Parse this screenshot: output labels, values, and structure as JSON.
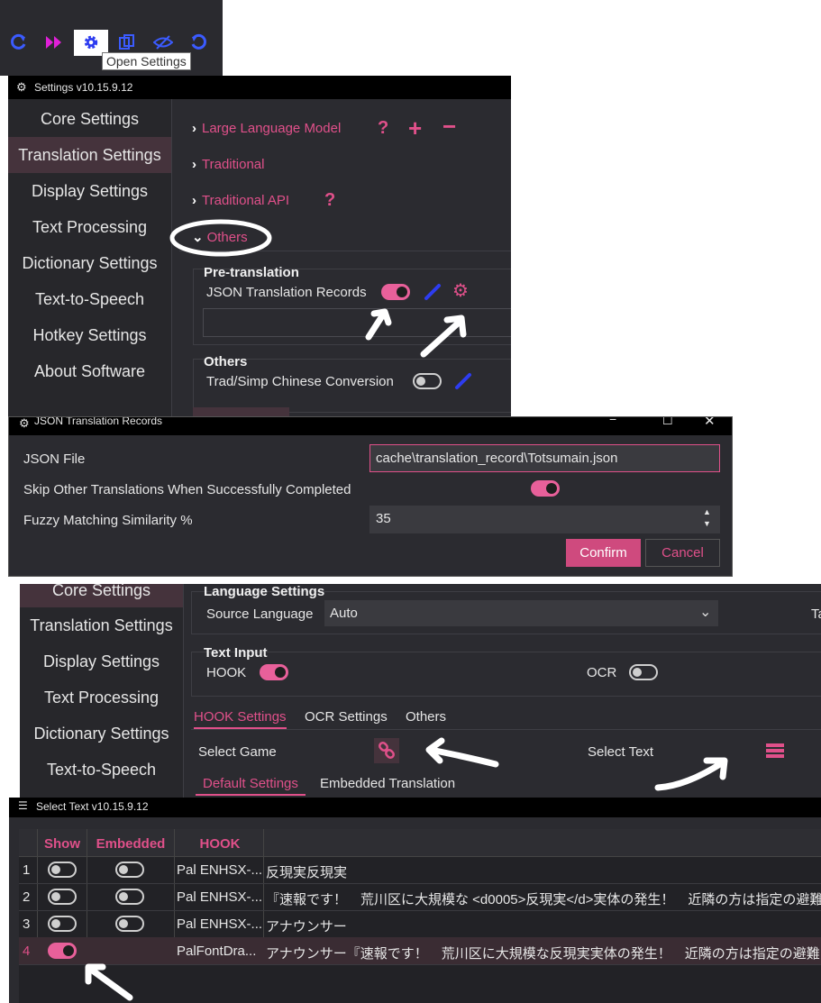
{
  "toolbar": {
    "tooltip": "Open Settings",
    "icons": [
      "reload-icon",
      "fast-forward-icon",
      "gear-icon",
      "copy-icon",
      "eye-slash-icon",
      "undo-icon"
    ]
  },
  "settings_window": {
    "title": "Settings v10.15.9.12",
    "nav": [
      "Core Settings",
      "Translation Settings",
      "Display Settings",
      "Text Processing",
      "Dictionary Settings",
      "Text-to-Speech",
      "Hotkey Settings",
      "About Software"
    ],
    "sections": [
      "Large Language Model",
      "Traditional",
      "Traditional API",
      "Others"
    ],
    "pretranslation_title": "Pre-translation",
    "json_records_label": "JSON Translation Records",
    "others_group_title": "Others",
    "trad_simp_label": "Trad/Simp Chinese Conversion"
  },
  "json_dialog": {
    "title": "JSON Translation Records",
    "json_file_label": "JSON File",
    "json_file_value": "cache\\translation_record\\Totsumain.json",
    "skip_label": "Skip Other Translations When Successfully Completed",
    "fuzzy_label": "Fuzzy Matching Similarity %",
    "fuzzy_value": "35",
    "confirm": "Confirm",
    "cancel": "Cancel"
  },
  "core_window": {
    "nav": [
      "Core Settings",
      "Translation Settings",
      "Display Settings",
      "Text Processing",
      "Dictionary Settings",
      "Text-to-Speech"
    ],
    "language_settings_title": "Language Settings",
    "source_language_label": "Source Language",
    "source_language_value": "Auto",
    "cut_label": "Ta",
    "text_input_title": "Text Input",
    "hook_label": "HOOK",
    "ocr_label": "OCR",
    "tabs": [
      "HOOK Settings",
      "OCR Settings",
      "Others"
    ],
    "select_game": "Select Game",
    "select_text": "Select Text",
    "subtabs": [
      "Default Settings",
      "Embedded Translation"
    ]
  },
  "select_text_window": {
    "title": "Select Text v10.15.9.12",
    "columns": [
      "Show",
      "Embedded",
      "HOOK"
    ],
    "rows": [
      {
        "num": "1",
        "hook": "Pal ENHSX-...",
        "text": "反現実反現実"
      },
      {
        "num": "2",
        "hook": "Pal ENHSX-...",
        "text": "『速報です！　荒川区に大規模な <d0005>反現実</d>実体の発生！　近隣の方は指定の避難"
      },
      {
        "num": "3",
        "hook": "Pal ENHSX-...",
        "text": "アナウンサー"
      },
      {
        "num": "4",
        "hook": "PalFontDra...",
        "text": "アナウンサー『速報です！　荒川区に大規模な反現実実体の発生！　近隣の方は指定の避難区域"
      }
    ]
  },
  "colors": {
    "accent": "#e0508a",
    "background": "#2b2b30",
    "titlebar": "#000000"
  }
}
